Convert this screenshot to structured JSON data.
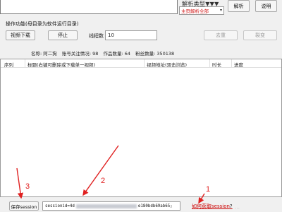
{
  "top": {
    "parse_type_label": "解析类型▼▼▼",
    "parse_type_value": "主页解析全部",
    "parse_button": "解析",
    "help_button": "说明"
  },
  "ops": {
    "label": "操作功能(母目录为软件运行目录)",
    "download_button": "视频下载",
    "stop_button": "停止",
    "thread_label": "线程数",
    "thread_value": "10",
    "dedupe_button": "去重",
    "copy_button": "裂变"
  },
  "info": {
    "name": "名称: 阿二狗",
    "follow": "账号关注情况: 98",
    "works": "作品数量: 64",
    "fans": "粉丝数量: 350138"
  },
  "table": {
    "columns": [
      "序列",
      "标题(右键可删除或下载单一视频)",
      "视频地址(双击浏览)",
      "时长",
      "进度"
    ]
  },
  "bottom": {
    "save_session_button": "保存session",
    "session_prefix": "sessionid=4d",
    "session_suffix": "e180bdb69ab65;",
    "how_link": "如何获取session",
    "how_q": "?",
    "watermark": "…"
  },
  "annotations": [
    "1",
    "2",
    "3"
  ],
  "colors": {
    "annotation_red": "#e02020",
    "link_red": "#cc0000"
  }
}
